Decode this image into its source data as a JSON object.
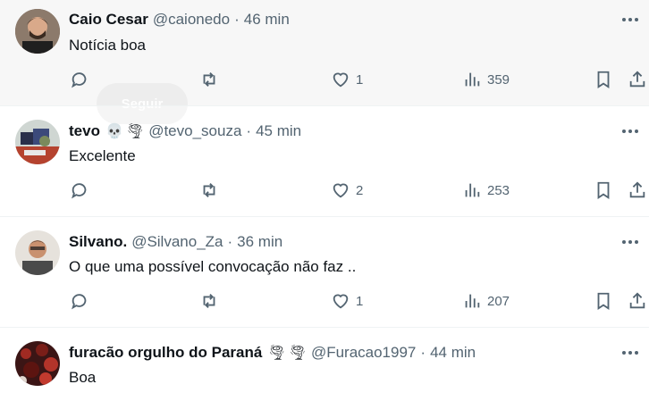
{
  "follow_ghost_label": "Seguir",
  "colors": {
    "text": "#0f1419",
    "muted": "#536471",
    "divider": "#eff3f4",
    "hover_bg": "#f7f7f7"
  },
  "tweets": [
    {
      "name": "Caio Cesar",
      "emojis": [],
      "handle": "@caionedo",
      "time": "46 min",
      "text": "Notícia boa",
      "likes": "1",
      "views": "359"
    },
    {
      "name": "tevo",
      "emojis": [
        "skull-icon",
        "tornado-icon"
      ],
      "handle": "@tevo_souza",
      "time": "45 min",
      "text": "Excelente",
      "likes": "2",
      "views": "253"
    },
    {
      "name": "Silvano.",
      "emojis": [],
      "handle": "@Silvano_Za",
      "time": "36 min",
      "text": "O que uma possível convocação não faz ..",
      "likes": "1",
      "views": "207"
    },
    {
      "name": "furacão orgulho do Paraná",
      "emojis": [
        "tornado-icon",
        "tornado-icon"
      ],
      "handle": "@Furacao1997",
      "time": "44 min",
      "text": "Boa"
    }
  ],
  "separator": "·"
}
